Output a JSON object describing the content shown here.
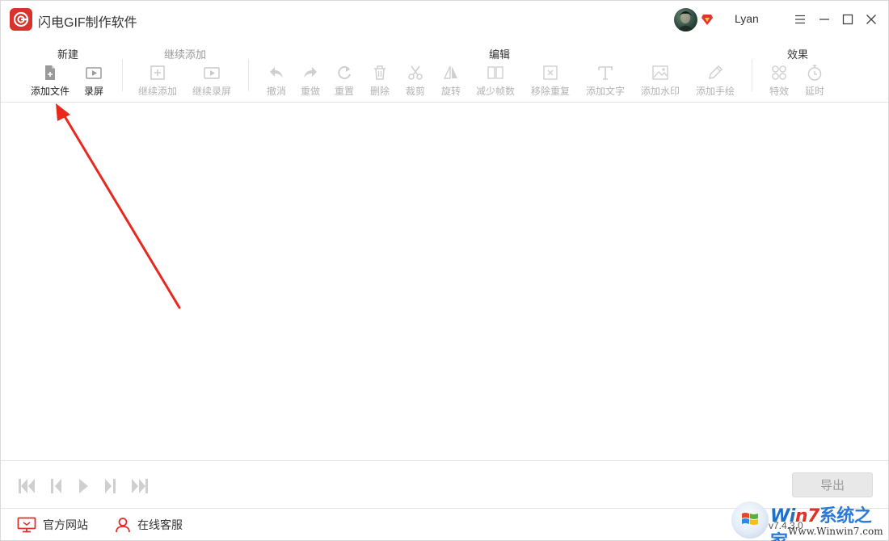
{
  "app": {
    "title": "闪电GIF制作软件"
  },
  "user": {
    "name": "Lyan"
  },
  "ribbon": {
    "groups": [
      {
        "title": "新建",
        "enabled": true
      },
      {
        "title": "继续添加",
        "enabled": false
      },
      {
        "title": "编辑",
        "enabled": true
      },
      {
        "title": "效果",
        "enabled": true
      }
    ],
    "tools": {
      "add_file": "添加文件",
      "record": "录屏",
      "continue_add": "继续添加",
      "continue_record": "继续录屏",
      "undo": "撤消",
      "redo": "重做",
      "reset": "重置",
      "delete": "删除",
      "crop": "裁剪",
      "rotate": "旋转",
      "reduce_frames": "减少帧数",
      "remove_duplicates": "移除重复",
      "add_text": "添加文字",
      "add_watermark": "添加水印",
      "add_drawing": "添加手绘",
      "effects": "特效",
      "delay": "延时"
    }
  },
  "playback": {
    "export_label": "导出"
  },
  "footer": {
    "website": "官方网站",
    "support": "在线客服"
  },
  "watermark": {
    "brand_a": "Wi",
    "brand_7": "n7",
    "brand_cn": "系统之家",
    "url": "Www.Winwin7.com"
  },
  "version": "v7.4.3.0",
  "colors": {
    "brand_red": "#d9312b",
    "arrow_red": "#e8271f",
    "disabled_gray": "#b3b3b3"
  }
}
